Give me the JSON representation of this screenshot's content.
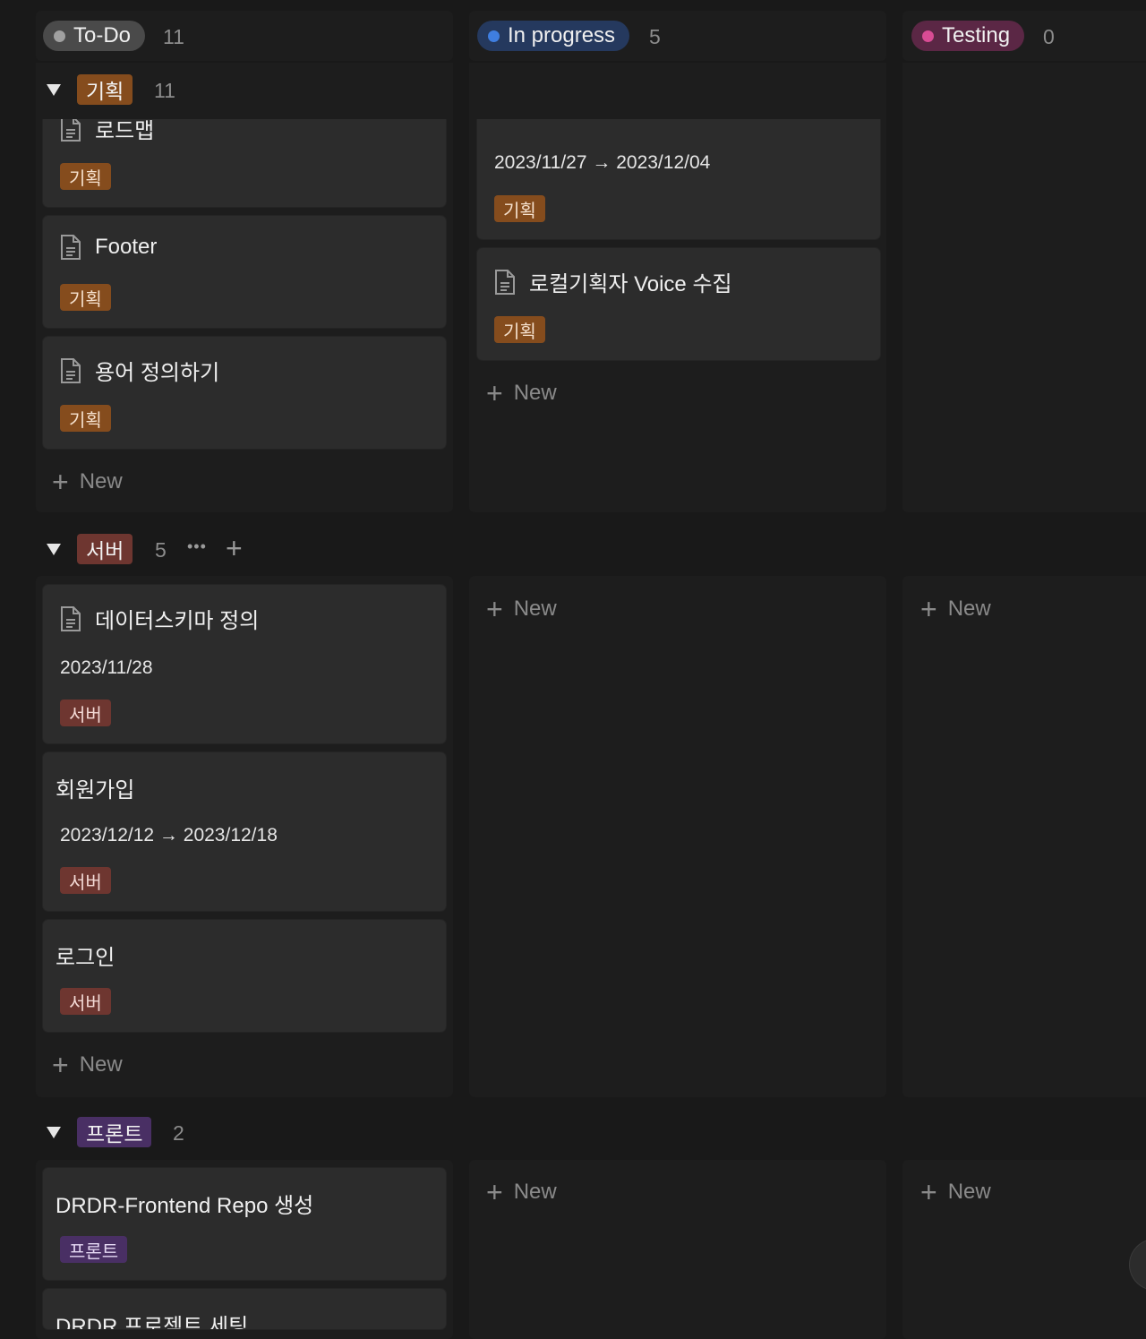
{
  "columns": [
    {
      "label": "To-Do",
      "count": "11",
      "dot_color": "#a0a0a0",
      "pill_color": "#4a4a4a"
    },
    {
      "label": "In progress",
      "count": "5",
      "dot_color": "#3f7ee0",
      "pill_color": "#25395e"
    },
    {
      "label": "Testing",
      "count": "0",
      "dot_color": "#d84c94",
      "pill_color": "#5b2745"
    }
  ],
  "groups": {
    "planning": {
      "label": "기획",
      "count": "11",
      "cards": [
        {
          "title": "로드맵",
          "tag": "기획"
        },
        {
          "title": "Footer",
          "tag": "기획"
        },
        {
          "title": "용어 정의하기",
          "tag": "기획"
        }
      ],
      "inprogress_cards": [
        {
          "title": "",
          "date": "2023/11/27 → 2023/12/04",
          "tag": "기획"
        },
        {
          "title": "로컬기획자 Voice 수집",
          "tag": "기획"
        }
      ]
    },
    "server": {
      "label": "서버",
      "count": "5",
      "more": "•••",
      "add": "+",
      "cards": [
        {
          "title": "데이터스키마 정의",
          "date": "2023/11/28",
          "tag": "서버"
        },
        {
          "title": "회원가입",
          "date": "2023/12/12 → 2023/12/18",
          "tag": "서버"
        },
        {
          "title": "로그인",
          "tag": "서버"
        }
      ]
    },
    "front": {
      "label": "프론트",
      "count": "2",
      "cards": [
        {
          "title": "DRDR-Frontend Repo 생성",
          "tag": "프론트"
        },
        {
          "title": "DRDR 프로젝트 세팅"
        }
      ]
    }
  },
  "new_label": "New",
  "plus_symbol": "+"
}
